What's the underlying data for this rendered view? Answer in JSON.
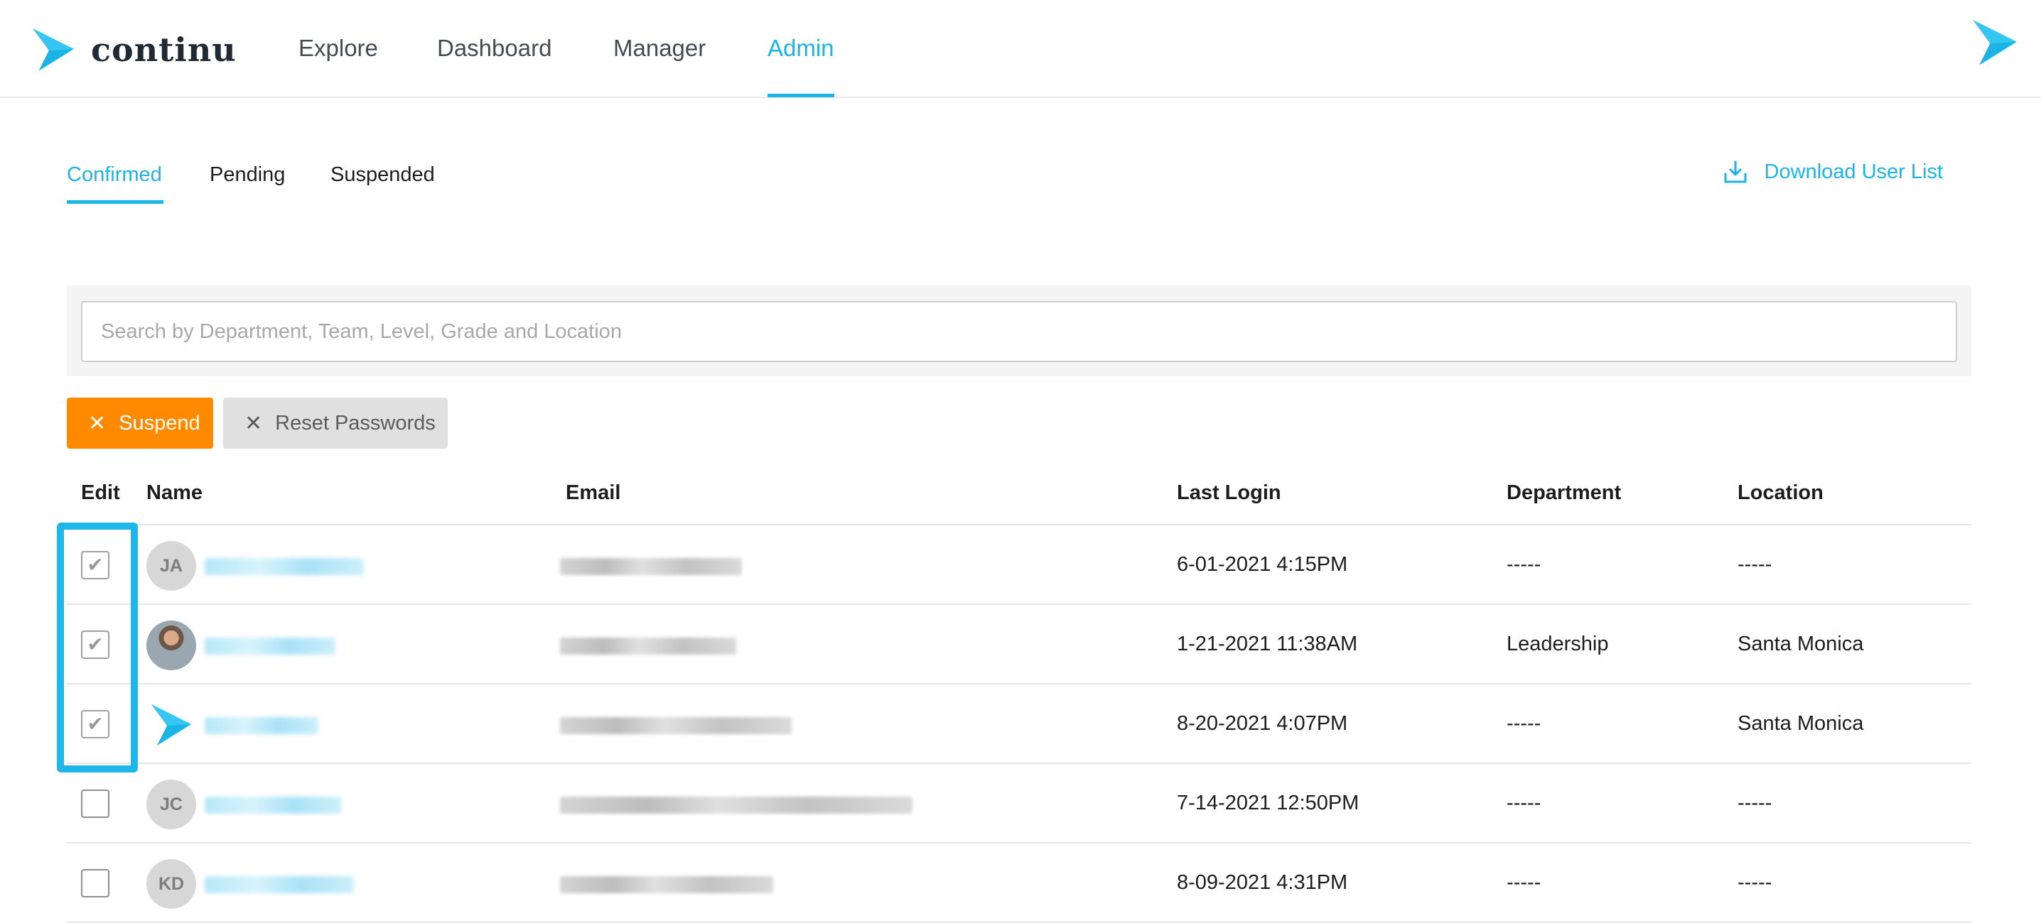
{
  "brand": {
    "name": "continu",
    "color": "#1ab4e6"
  },
  "nav": {
    "items": [
      {
        "label": "Explore"
      },
      {
        "label": "Dashboard"
      },
      {
        "label": "Manager"
      },
      {
        "label": "Admin"
      }
    ],
    "active": "Admin"
  },
  "tabs": {
    "items": [
      {
        "label": "Confirmed"
      },
      {
        "label": "Pending"
      },
      {
        "label": "Suspended"
      }
    ],
    "active": "Confirmed"
  },
  "download": {
    "label": "Download User List",
    "icon": "download-icon"
  },
  "search": {
    "placeholder": "Search by Department, Team, Level, Grade and Location",
    "value": ""
  },
  "actions": {
    "suspend_label": "Suspend",
    "suspend_color": "#ff8a00",
    "reset_label": "Reset Passwords"
  },
  "table": {
    "headers": {
      "edit": "Edit",
      "name": "Name",
      "email": "Email",
      "last_login": "Last Login",
      "department": "Department",
      "location": "Location"
    },
    "rows": [
      {
        "checked": true,
        "avatar": "JA",
        "last_login": "6-01-2021 4:15PM",
        "department": "-----",
        "location": "-----"
      },
      {
        "checked": true,
        "avatar": "",
        "last_login": "1-21-2021 11:38AM",
        "department": "Leadership",
        "location": "Santa Monica"
      },
      {
        "checked": true,
        "avatar": "",
        "last_login": "8-20-2021 4:07PM",
        "department": "-----",
        "location": "Santa Monica"
      },
      {
        "checked": false,
        "avatar": "JC",
        "last_login": "7-14-2021 12:50PM",
        "department": "-----",
        "location": "-----"
      },
      {
        "checked": false,
        "avatar": "KD",
        "last_login": "8-09-2021 4:31PM",
        "department": "-----",
        "location": "-----"
      }
    ]
  },
  "highlight_color": "#1fb6ea"
}
